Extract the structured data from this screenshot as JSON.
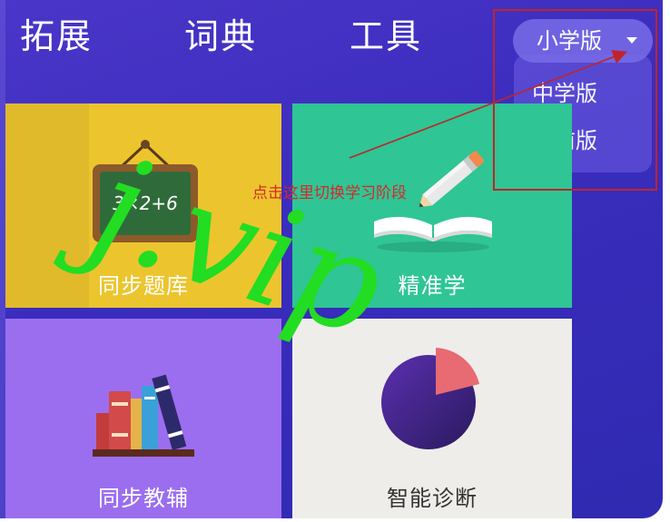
{
  "top_tabs": {
    "expand": "拓展",
    "dictionary": "词典",
    "tools": "工具"
  },
  "grade_dropdown": {
    "selected": "小学版",
    "options": [
      "中学版",
      "学前版"
    ]
  },
  "cards": {
    "sync_bank": {
      "label": "同步题库",
      "board_text": "3×2+6"
    },
    "precise": {
      "label": "精准学"
    },
    "sync_tutor": {
      "label": "同步教辅"
    },
    "diagnose": {
      "label": "智能诊断"
    }
  },
  "annotation": {
    "text": "点击这里切换学习阶段",
    "color": "#d42a2a"
  },
  "watermark": {
    "text": "j.vip",
    "color": "#22dd22"
  },
  "colors": {
    "background": "#3a2cbd",
    "card_yellow": "#ecc52e",
    "card_green": "#2fc595",
    "card_purple": "#9b6ef0",
    "card_light": "#efedea"
  }
}
